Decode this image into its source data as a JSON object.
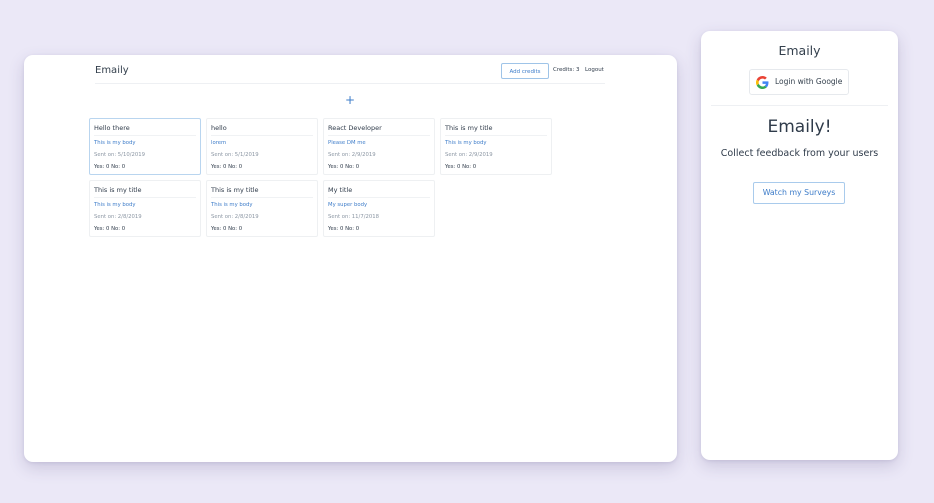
{
  "desktop": {
    "brand": "Emaily",
    "add_credits_label": "Add credits",
    "credits_text": "Credits: 3",
    "logout_label": "Logout",
    "add_survey_label": "+",
    "surveys": [
      {
        "title": "Hello there",
        "body": "This is my body",
        "sent": "Sent on: 5/10/2019",
        "votes": "Yes: 0 No: 0"
      },
      {
        "title": "hello",
        "body": "lorem",
        "sent": "Sent on: 5/1/2019",
        "votes": "Yes: 0 No: 0"
      },
      {
        "title": "React Developer",
        "body": "Please DM me",
        "sent": "Sent on: 2/9/2019",
        "votes": "Yes: 0 No: 0"
      },
      {
        "title": "This is my title",
        "body": "This is my body",
        "sent": "Sent on: 2/9/2019",
        "votes": "Yes: 0 No: 0"
      },
      {
        "title": "This is my title",
        "body": "This is my body",
        "sent": "Sent on: 2/8/2019",
        "votes": "Yes: 0 No: 0"
      },
      {
        "title": "This is my title",
        "body": "This is my body",
        "sent": "Sent on: 2/8/2019",
        "votes": "Yes: 0 No: 0"
      },
      {
        "title": "My title",
        "body": "My super body",
        "sent": "Sent on: 11/7/2018",
        "votes": "Yes: 0 No: 0"
      }
    ]
  },
  "mobile": {
    "brand": "Emaily",
    "login_label": "Login with Google",
    "login_icon": "google-icon",
    "hero_title": "Emaily!",
    "tagline": "Collect feedback from your users",
    "watch_label": "Watch my Surveys"
  },
  "colors": {
    "background": "#ebe8f7",
    "accent": "#3d7cc9",
    "text": "#2f3b4a"
  }
}
